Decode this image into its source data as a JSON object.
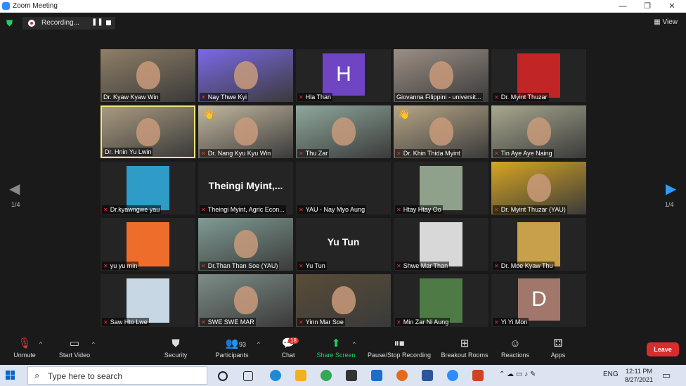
{
  "window": {
    "title": "Zoom Meeting"
  },
  "recording": {
    "label": "Recording..."
  },
  "view_label": "View",
  "page_indicator": "1/4",
  "participants": [
    {
      "name": "Dr. Kyaw Kyaw Win",
      "type": "video",
      "bg": "#8f7f66",
      "muted": false
    },
    {
      "name": "Nay Thwe Kyi",
      "type": "video",
      "bg": "#7b69e6",
      "muted": true
    },
    {
      "name": "Hla Than",
      "type": "letter",
      "letter": "H",
      "bg": "#6f45c4",
      "muted": true
    },
    {
      "name": "Giovanna Filippini - universit...",
      "type": "video",
      "bg": "#9c8f85",
      "muted": false
    },
    {
      "name": "Dr. Myint Thuzar",
      "type": "avatar",
      "bg": "#c22525",
      "muted": true
    },
    {
      "name": "Dr. Hnin Yu Lwin",
      "type": "video",
      "bg": "#a89a80",
      "muted": false,
      "active": true
    },
    {
      "name": "Dr. Nang Kyu Kyu Win",
      "type": "video",
      "bg": "#c3b8a0",
      "muted": true,
      "hand": true
    },
    {
      "name": "Thu Zar",
      "type": "video",
      "bg": "#8fa89c",
      "muted": true
    },
    {
      "name": "Dr. Khin Thida Myint",
      "type": "video",
      "bg": "#b7a687",
      "muted": true,
      "hand": true
    },
    {
      "name": "Tin Aye Aye Naing",
      "type": "video",
      "bg": "#a9a88f",
      "muted": true
    },
    {
      "name": "Dr.kyawngwe yau",
      "type": "avatar",
      "bg": "#2f9bc7",
      "muted": true
    },
    {
      "name": "Theingi Myint, Agric Econ...",
      "type": "bigname",
      "display": "Theingi  Myint,...",
      "muted": true
    },
    {
      "name": "YAU - Nay Myo Aung",
      "type": "blank",
      "muted": true
    },
    {
      "name": "Htay Htay Oo",
      "type": "avatar",
      "bg": "#8fa08b",
      "muted": true
    },
    {
      "name": "Dr. Myint Thuzar (YAU)",
      "type": "video",
      "bg": "#d7a521",
      "muted": true
    },
    {
      "name": "yu yu min",
      "type": "avatar",
      "bg": "#ef6d2a",
      "muted": true
    },
    {
      "name": "Dr.Than Than Soe (YAU)",
      "type": "video",
      "bg": "#7f9b93",
      "muted": true
    },
    {
      "name": "Yu Tun",
      "type": "bigname",
      "display": "Yu Tun",
      "muted": true
    },
    {
      "name": "Shwe Mar Than",
      "type": "avatar",
      "bg": "#d8d8d8",
      "muted": true
    },
    {
      "name": "Dr. Moe Kyaw Thu",
      "type": "avatar",
      "bg": "#c9a04a",
      "muted": true
    },
    {
      "name": "Saw Hto Lwe",
      "type": "avatar",
      "bg": "#c7d7e3",
      "muted": true
    },
    {
      "name": "SWE SWE MAR",
      "type": "video",
      "bg": "#7d8d88",
      "muted": true
    },
    {
      "name": "Yinn Mar Soe",
      "type": "video",
      "bg": "#5a4c38",
      "muted": true
    },
    {
      "name": "Min Zar Ni Aung",
      "type": "avatar",
      "bg": "#4d7a45",
      "muted": true
    },
    {
      "name": "Yi Yi Mon",
      "type": "letter",
      "letter": "D",
      "bg": "#a0776a",
      "muted": true
    }
  ],
  "toolbar": {
    "unmute": "Unmute",
    "start_video": "Start Video",
    "security": "Security",
    "participants": "Participants",
    "participants_count": "93",
    "chat": "Chat",
    "chat_badge": "18",
    "share": "Share Screen",
    "record": "Pause/Stop Recording",
    "breakout": "Breakout Rooms",
    "reactions": "Reactions",
    "apps": "Apps",
    "leave": "Leave"
  },
  "taskbar": {
    "search_placeholder": "Type here to search",
    "lang": "ENG",
    "time": "12:11 PM",
    "date": "8/27/2021"
  },
  "colors": {
    "share_green": "#23d160",
    "leave_red": "#d92d2d",
    "arrow_blue": "#2d9cff",
    "active_border": "#f5e67a"
  }
}
